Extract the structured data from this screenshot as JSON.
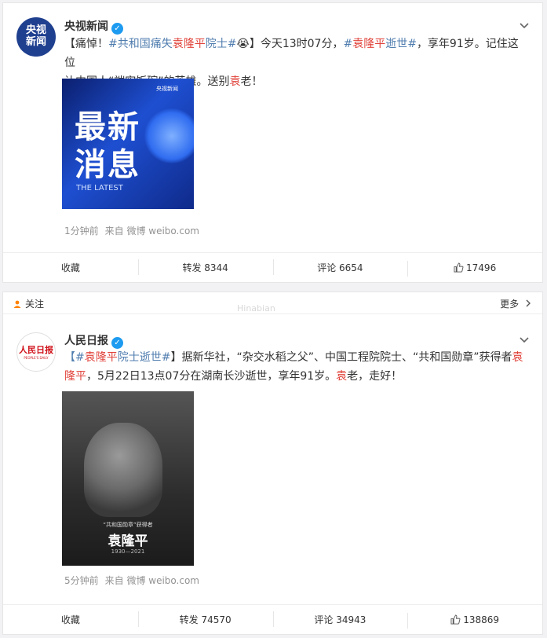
{
  "post1": {
    "author": "央视新闻",
    "avatar_text": [
      "央视",
      "新闻"
    ],
    "text_line1_parts": [
      "【痛悼！",
      "#共和国痛失",
      "袁隆平",
      "院士#",
      "😭",
      "】今天13时07分，",
      "#",
      "袁隆平",
      "逝世#",
      "，享年91岁。记住这位"
    ],
    "text_line2_parts": [
      "让中国人“端牢饭碗”的英雄。送别",
      "袁",
      "老！"
    ],
    "image": {
      "big_text": "最新消息",
      "sub_text": "THE LATEST",
      "corner": "央视新闻"
    },
    "meta": {
      "time": "1分钟前",
      "source": "来自 微博 weibo.com"
    },
    "actions": {
      "favorite": "收藏",
      "repost": "转发 8344",
      "comment": "评论 6654",
      "like": "17496"
    }
  },
  "post2": {
    "follow_label": "关注",
    "more_label": "更多",
    "watermark": "Hinabian",
    "author": "人民日报",
    "avatar_text": "人民日报",
    "avatar_sub": "PEOPLE'S DAILY",
    "text_line1_parts": [
      "【#",
      "袁隆平",
      "院士逝世#",
      "】据新华社，“杂交水稻之父”、中国工程院院士、“共和国勋章”获得者",
      "袁"
    ],
    "text_line2_parts": [
      "隆平",
      "，5月22日13点07分在湖南长沙逝世，享年91岁。",
      "袁",
      "老，走好！"
    ],
    "image": {
      "caption_small": "“共和国勋章”获得者",
      "name": "袁隆平",
      "years": "1930—2021"
    },
    "meta": {
      "time": "5分钟前",
      "source": "来自 微博 weibo.com"
    },
    "actions": {
      "favorite": "收藏",
      "repost": "转发 74570",
      "comment": "评论 34943",
      "like": "138869"
    }
  }
}
